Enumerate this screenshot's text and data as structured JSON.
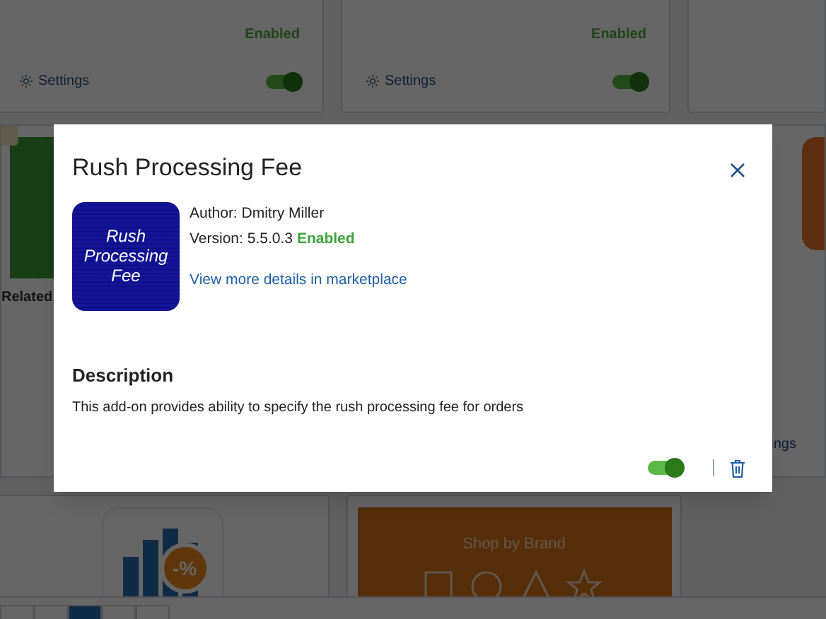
{
  "background": {
    "top_cards": [
      {
        "status": "Enabled",
        "settings": "Settings",
        "enabled": true
      },
      {
        "status": "Enabled",
        "settings": "Settings",
        "enabled": true
      }
    ],
    "left_card": {
      "label": "Related"
    },
    "right_card": {
      "link": "ings"
    },
    "bottom_cards": [
      {
        "kind": "chart",
        "badge": "-%"
      },
      {
        "kind": "banner",
        "title": "Shop by Brand"
      }
    ]
  },
  "dialog": {
    "title": "Rush Processing Fee",
    "logo_lines": [
      "Rush",
      "Processing",
      "Fee"
    ],
    "author_label": "Author:",
    "author": "Dmitry Miller",
    "version_label": "Version:",
    "version": "5.5.0.3",
    "status": "Enabled",
    "link": "View more details in marketplace",
    "description_heading": "Description",
    "description": "This add-on provides ability to specify the rush processing fee for orders",
    "enabled": true
  }
}
